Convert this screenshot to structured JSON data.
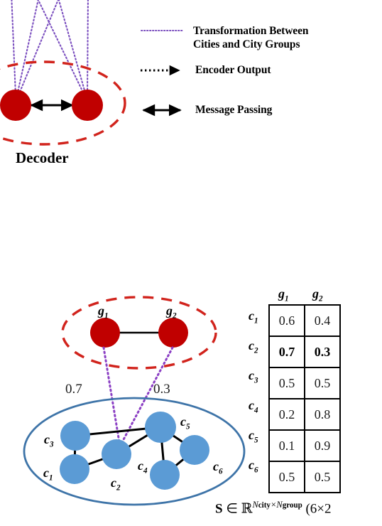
{
  "legend": {
    "items": [
      {
        "id": "transformation",
        "label": "Transformation Between\nCities and City Groups",
        "style": "purple-dotted-line",
        "color": "#7B4FBF"
      },
      {
        "id": "encoder-output",
        "label": "Encoder Output",
        "style": "black-dotted-arrow",
        "color": "#000000"
      },
      {
        "id": "message-passing",
        "label": "Message Passing",
        "style": "black-double-arrow",
        "color": "#000000"
      }
    ]
  },
  "decoder": {
    "caption": "Decoder",
    "node_color": "#C00000",
    "boundary_color": "#D1231C"
  },
  "group_graph": {
    "boundary_color": "#D1231C",
    "node_color": "#C00000",
    "nodes": [
      {
        "id": "g1",
        "label": "g",
        "sub": "1"
      },
      {
        "id": "g2",
        "label": "g",
        "sub": "2"
      }
    ],
    "edges": [
      [
        "g1",
        "g2"
      ]
    ],
    "assignment_weights": [
      {
        "id": "w-g1",
        "value": "0.7"
      },
      {
        "id": "w-g2",
        "value": "0.3"
      }
    ]
  },
  "city_graph": {
    "boundary_color": "#3E74A8",
    "node_color": "#5B9BD5",
    "nodes": [
      {
        "id": "c1",
        "label": "c",
        "sub": "1"
      },
      {
        "id": "c2",
        "label": "c",
        "sub": "2"
      },
      {
        "id": "c3",
        "label": "c",
        "sub": "3"
      },
      {
        "id": "c4",
        "label": "c",
        "sub": "4"
      },
      {
        "id": "c5",
        "label": "c",
        "sub": "5"
      },
      {
        "id": "c6",
        "label": "c",
        "sub": "6"
      }
    ],
    "edges": [
      [
        "c3",
        "c1"
      ],
      [
        "c3",
        "c5"
      ],
      [
        "c1",
        "c2"
      ],
      [
        "c2",
        "c5"
      ],
      [
        "c5",
        "c4"
      ],
      [
        "c5",
        "c6"
      ],
      [
        "c4",
        "c6"
      ]
    ]
  },
  "chart_data": {
    "type": "table",
    "title": "",
    "col_headers": [
      {
        "label": "g",
        "sub": "1"
      },
      {
        "label": "g",
        "sub": "2"
      }
    ],
    "row_headers": [
      {
        "label": "c",
        "sub": "1"
      },
      {
        "label": "c",
        "sub": "2"
      },
      {
        "label": "c",
        "sub": "3"
      },
      {
        "label": "c",
        "sub": "4"
      },
      {
        "label": "c",
        "sub": "5"
      },
      {
        "label": "c",
        "sub": "6"
      }
    ],
    "rows": [
      {
        "cells": [
          "0.6",
          "0.4"
        ],
        "bold": false
      },
      {
        "cells": [
          "0.7",
          "0.3"
        ],
        "bold": true
      },
      {
        "cells": [
          "0.5",
          "0.5"
        ],
        "bold": false
      },
      {
        "cells": [
          "0.2",
          "0.8"
        ],
        "bold": false
      },
      {
        "cells": [
          "0.1",
          "0.9"
        ],
        "bold": false
      },
      {
        "cells": [
          "0.5",
          "0.5"
        ],
        "bold": false
      }
    ]
  },
  "formula": {
    "matrix_symbol": "S",
    "member_symbol": "∈",
    "field_symbol": "ℝ",
    "exp_rows": "N",
    "exp_rows_sub": "city",
    "exp_times": "×",
    "exp_cols": "N",
    "exp_cols_sub": "group",
    "dims": "(6×2"
  }
}
